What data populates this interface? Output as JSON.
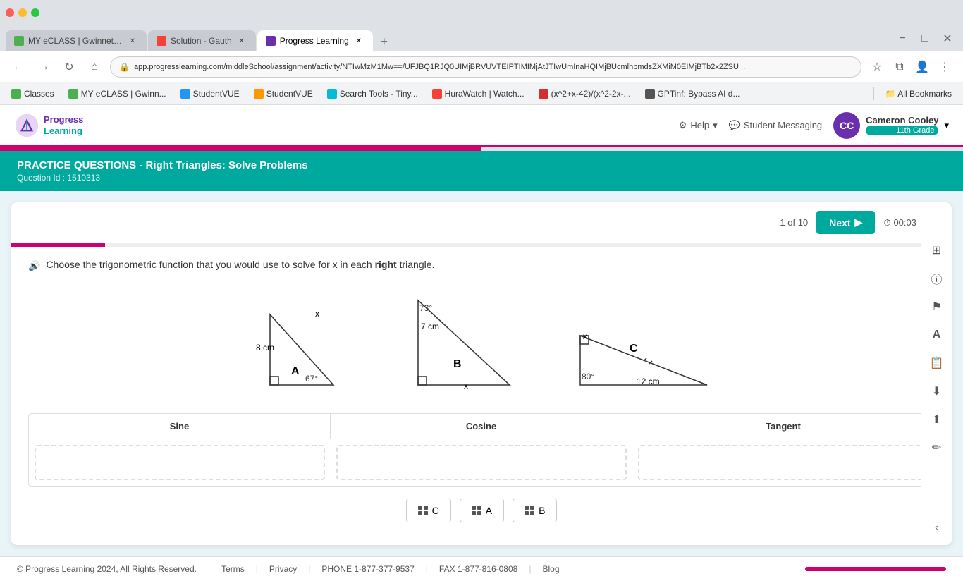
{
  "browser": {
    "tabs": [
      {
        "id": "tab1",
        "label": "MY eCLASS | Gwinnett County...",
        "favicon_color": "#4caf50",
        "active": false
      },
      {
        "id": "tab2",
        "label": "Solution - Gauth",
        "favicon_color": "#f44336",
        "active": false
      },
      {
        "id": "tab3",
        "label": "Progress Learning",
        "favicon_color": "#6b2fad",
        "active": true
      }
    ],
    "url": "app.progresslearning.com/middleSchool/assignment/activity/NTIwMzM1Mw==/UFJBQ1RJQ0UIMjBRVUVTEIPTIMIMjAtJTIwUmInaHQIMjBUcmlhbmdsZXMiM0EIMjBTb2x2ZSU...",
    "new_tab_label": "+"
  },
  "bookmarks": [
    {
      "label": "Classes",
      "favicon_color": "#4caf50"
    },
    {
      "label": "MY eCLASS | Gwinn...",
      "favicon_color": "#4caf50"
    },
    {
      "label": "StudentVUE",
      "favicon_color": "#2196f3"
    },
    {
      "label": "StudentVUE",
      "favicon_color": "#ff9800"
    },
    {
      "label": "Search Tools - Tiny...",
      "favicon_color": "#00bcd4"
    },
    {
      "label": "HuraWatch | Watch...",
      "favicon_color": "#f44336"
    },
    {
      "label": "(x^2+x-42)/(x^2-2x-...",
      "favicon_color": "#d32f2f"
    },
    {
      "label": "GPTinf: Bypass AI d...",
      "favicon_color": "#555"
    }
  ],
  "header": {
    "logo_line1": "Progress",
    "logo_line2": "Learning",
    "help_label": "Help",
    "messaging_label": "Student Messaging",
    "user_name": "Cameron Cooley",
    "user_grade": "11th Grade",
    "user_initials": "CC"
  },
  "practice": {
    "title": "PRACTICE QUESTIONS - Right Triangles: Solve Problems",
    "question_id": "Question Id : 1510313"
  },
  "question": {
    "counter": "1 of 10",
    "next_label": "Next",
    "timer": "00:03",
    "progress_pct": 10,
    "instruction": "Choose the trigonometric function that you would use to solve for x in each",
    "instruction_bold": "right",
    "instruction_end": "triangle.",
    "triangles": [
      {
        "label": "A",
        "side1": "8 cm",
        "side2": "x",
        "angle": "67°"
      },
      {
        "label": "B",
        "angle": "73°",
        "side1": "7 cm",
        "side2": "x"
      },
      {
        "label": "C",
        "angle": "80°",
        "side1": "12 cm",
        "side2": "x"
      }
    ],
    "table_headers": [
      "Sine",
      "Cosine",
      "Tangent"
    ],
    "chips": [
      {
        "label": "C"
      },
      {
        "label": "A"
      },
      {
        "label": "B"
      }
    ]
  },
  "sidebar_icons": [
    {
      "name": "calculator-icon",
      "symbol": "⊞"
    },
    {
      "name": "info-icon",
      "symbol": "ⓘ"
    },
    {
      "name": "flag-icon",
      "symbol": "⚑"
    },
    {
      "name": "text-icon",
      "symbol": "A"
    },
    {
      "name": "document-icon",
      "symbol": "📄"
    },
    {
      "name": "download-icon",
      "symbol": "⬇"
    },
    {
      "name": "upload-icon",
      "symbol": "⬆"
    },
    {
      "name": "pencil-icon",
      "symbol": "✏"
    }
  ],
  "footer": {
    "copyright": "© Progress Learning 2024, All Rights Reserved.",
    "terms": "Terms",
    "privacy": "Privacy",
    "phone": "PHONE 1-877-377-9537",
    "fax": "FAX 1-877-816-0808",
    "blog": "Blog"
  }
}
